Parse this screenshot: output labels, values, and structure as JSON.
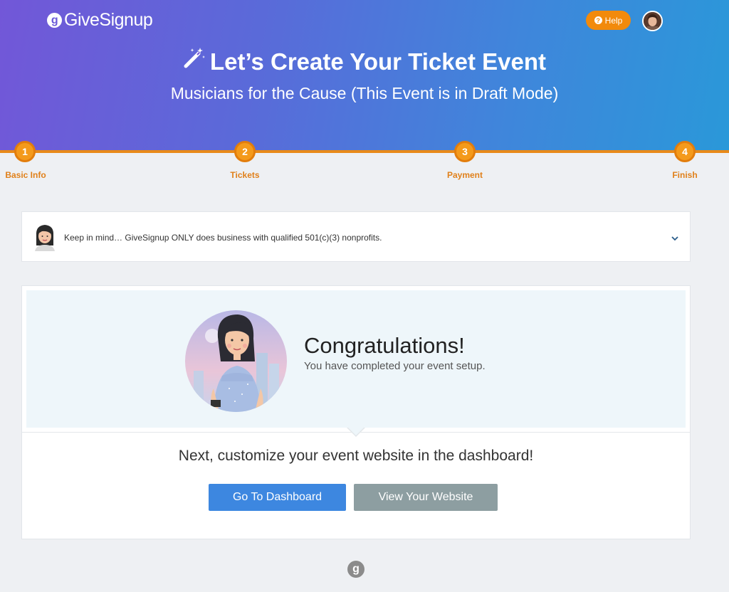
{
  "header": {
    "logo_mark": "g",
    "logo_text": "GiveSignup",
    "help_label": "Help",
    "help_icon_glyph": "?"
  },
  "hero": {
    "title": "Let’s Create Your Ticket Event",
    "subtitle": "Musicians for the Cause (This Event is in Draft Mode)"
  },
  "steps": [
    {
      "number": "1",
      "label": "Basic Info"
    },
    {
      "number": "2",
      "label": "Tickets"
    },
    {
      "number": "3",
      "label": "Payment"
    },
    {
      "number": "4",
      "label": "Finish"
    }
  ],
  "notice": {
    "text": "Keep in mind… GiveSignup ONLY does business with qualified 501(c)(3) nonprofits."
  },
  "completion": {
    "title": "Congratulations!",
    "subtitle": "You have completed your event setup.",
    "next_text": "Next, customize your event website in the dashboard!",
    "dashboard_button": "Go To Dashboard",
    "website_button": "View Your Website"
  },
  "footer": {
    "logo_mark": "g"
  },
  "colors": {
    "accent_orange": "#f28a0c",
    "primary_blue": "#3d87e0",
    "secondary_gray": "#8d9ea1",
    "gradient_start": "#7257d8",
    "gradient_end": "#2a98d9"
  }
}
